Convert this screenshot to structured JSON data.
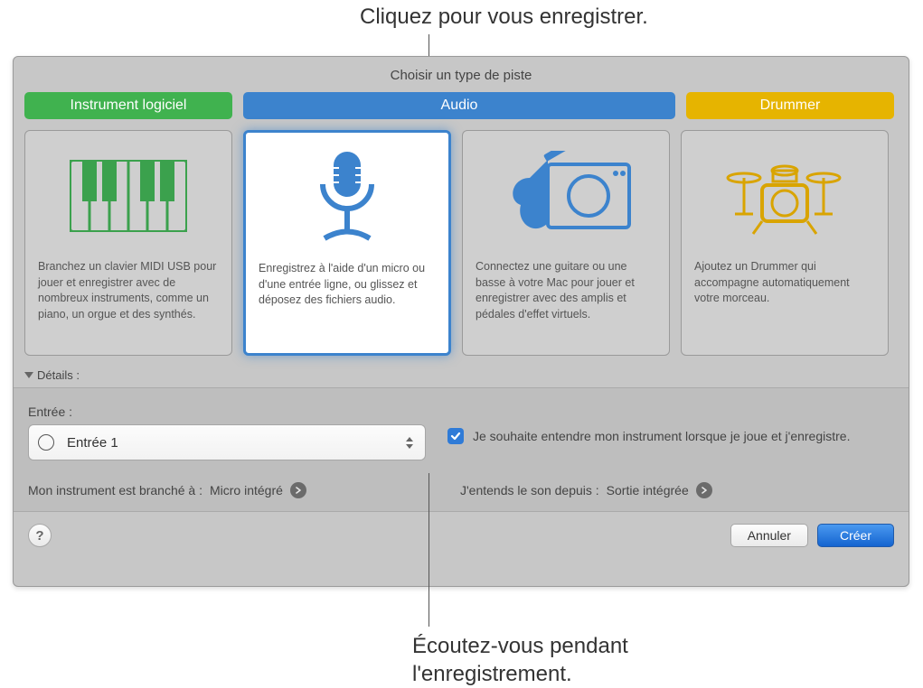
{
  "annotations": {
    "top": "Cliquez pour vous enregistrer.",
    "bottom": "Écoutez-vous pendant\nl'enregistrement."
  },
  "dialog": {
    "title": "Choisir un type de piste",
    "headerTabs": {
      "software": "Instrument logiciel",
      "audio": "Audio",
      "drummer": "Drummer"
    },
    "cards": [
      {
        "desc": "Branchez un clavier MIDI USB pour jouer et enregistrer avec de nombreux instruments, comme un piano, un orgue et des synthés."
      },
      {
        "desc": "Enregistrez à l'aide d'un micro ou d'une entrée ligne, ou glissez et déposez des fichiers audio."
      },
      {
        "desc": "Connectez une guitare ou une basse à votre Mac pour jouer et enregistrer avec des amplis et pédales d'effet virtuels."
      },
      {
        "desc": "Ajoutez un Drummer qui accompagne automatiquement votre morceau."
      }
    ],
    "detailsLabel": "Détails :",
    "input": {
      "label": "Entrée :",
      "value": "Entrée 1"
    },
    "monitor": {
      "checked": true,
      "label": "Je souhaite entendre mon instrument lorsque je joue et j'enregistre."
    },
    "instrumentLink": {
      "prefix": "Mon instrument est branché à : ",
      "value": "Micro intégré"
    },
    "outputLink": {
      "prefix": "J'entends le son depuis : ",
      "value": "Sortie intégrée"
    },
    "buttons": {
      "help": "?",
      "cancel": "Annuler",
      "create": "Créer"
    }
  }
}
